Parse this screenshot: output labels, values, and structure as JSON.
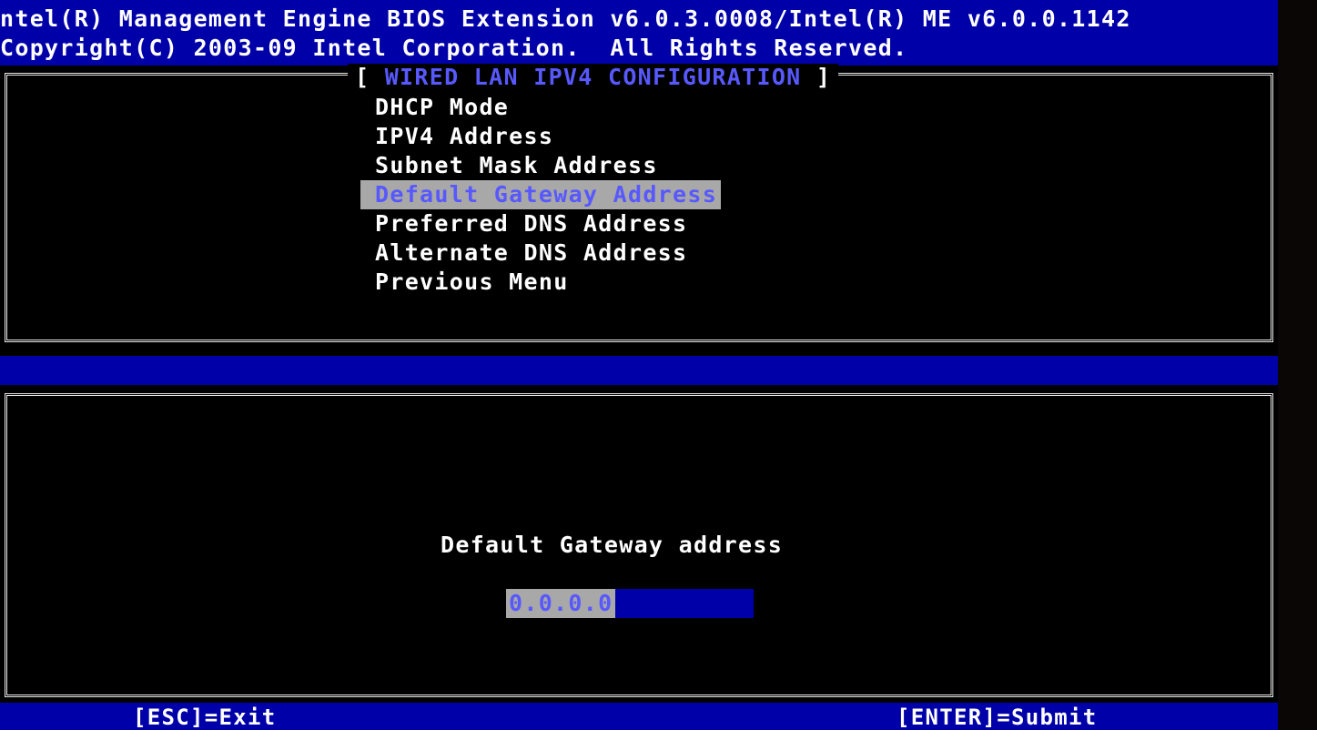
{
  "header": {
    "line1": "ntel(R) Management Engine BIOS Extension v6.0.3.0008/Intel(R) ME v6.0.0.1142",
    "line2": "Copyright(C) 2003-09 Intel Corporation.  All Rights Reserved."
  },
  "menu": {
    "title": "WIRED LAN IPV4 CONFIGURATION",
    "title_open": "[ ",
    "title_close": " ]",
    "items": [
      {
        "label": "DHCP Mode"
      },
      {
        "label": "IPV4 Address"
      },
      {
        "label": "Subnet Mask Address"
      },
      {
        "label": "Default Gateway Address",
        "selected": true
      },
      {
        "label": "Preferred DNS Address"
      },
      {
        "label": "Alternate DNS Address"
      },
      {
        "label": "Previous Menu"
      }
    ]
  },
  "status_bar": {
    "text": ""
  },
  "input_dialog": {
    "prompt": "Default Gateway address",
    "value": "0.0.0.0"
  },
  "footer": {
    "esc": "[ESC]=Exit",
    "enter": "[ENTER]=Submit"
  },
  "colors": {
    "bios_blue": "#0000a8",
    "highlight_bg": "#a8a8a8",
    "highlight_fg": "#5858ff",
    "text": "#ffffff",
    "background": "#000000"
  }
}
